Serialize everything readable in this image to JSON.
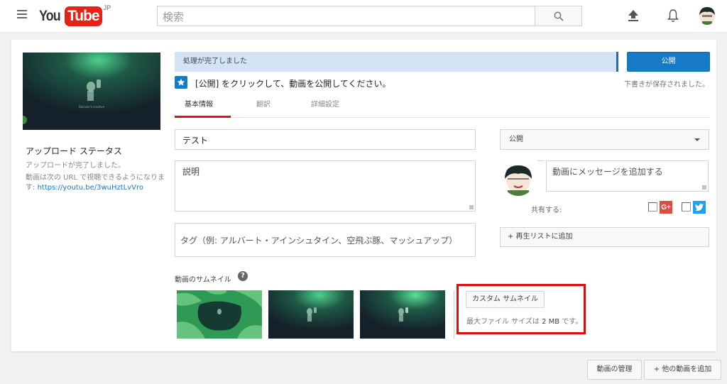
{
  "header": {
    "logo_you": "You",
    "logo_tube": "Tube",
    "logo_region": "JP",
    "search_placeholder": "検索",
    "icons": [
      "menu-icon",
      "search-icon",
      "upload-icon",
      "bell-icon",
      "avatar"
    ]
  },
  "sidebar": {
    "status_title": "アップロード ステータス",
    "status_done": "アップロードが完了しました。",
    "url_prefix": "動画は次の URL で視聴できるようになります: ",
    "url": "https://youtu.be/3wuHztLvVro"
  },
  "main": {
    "processing_text": "処理が完了しました",
    "publish_label": "公開",
    "draft_saved": "下書きが保存されました。",
    "hint": "[公開] をクリックして、動画を公開してください。",
    "tabs": [
      {
        "label": "基本情報",
        "active": true
      },
      {
        "label": "翻訳",
        "active": false
      },
      {
        "label": "詳細設定",
        "active": false
      }
    ],
    "title_value": "テスト",
    "description_placeholder": "説明",
    "tags_placeholder": "タグ（例: アルバート・アインシュタイン、空飛ぶ豚、マッシュアップ）",
    "privacy_selected": "公開",
    "message_placeholder": "動画にメッセージを追加する",
    "share_label": "共有する:",
    "share_targets": [
      {
        "name": "Google+",
        "glyph": "G+",
        "color": "#dc4e41",
        "checked": false
      },
      {
        "name": "Twitter",
        "glyph": "t",
        "color": "#1da1f2",
        "checked": false
      }
    ],
    "playlist_label": "+ 再生リストに追加",
    "thumbnails_label": "動画のサムネイル",
    "thumbnails_help": "?",
    "custom_thumbnail_label": "カスタム サムネイル",
    "max_size_prefix": "最大ファイル サイズは ",
    "max_size_value": "2 MB",
    "max_size_suffix": " です。"
  },
  "footer": {
    "manage_label": "動画の管理",
    "add_more_label": "+ 他の動画を追加"
  },
  "colors": {
    "accent": "#167ac6",
    "youtube_red": "#e62117",
    "tab_underline": "#cc181e",
    "highlight": "#d90d0d",
    "processing_bg": "#d3e5f5"
  }
}
